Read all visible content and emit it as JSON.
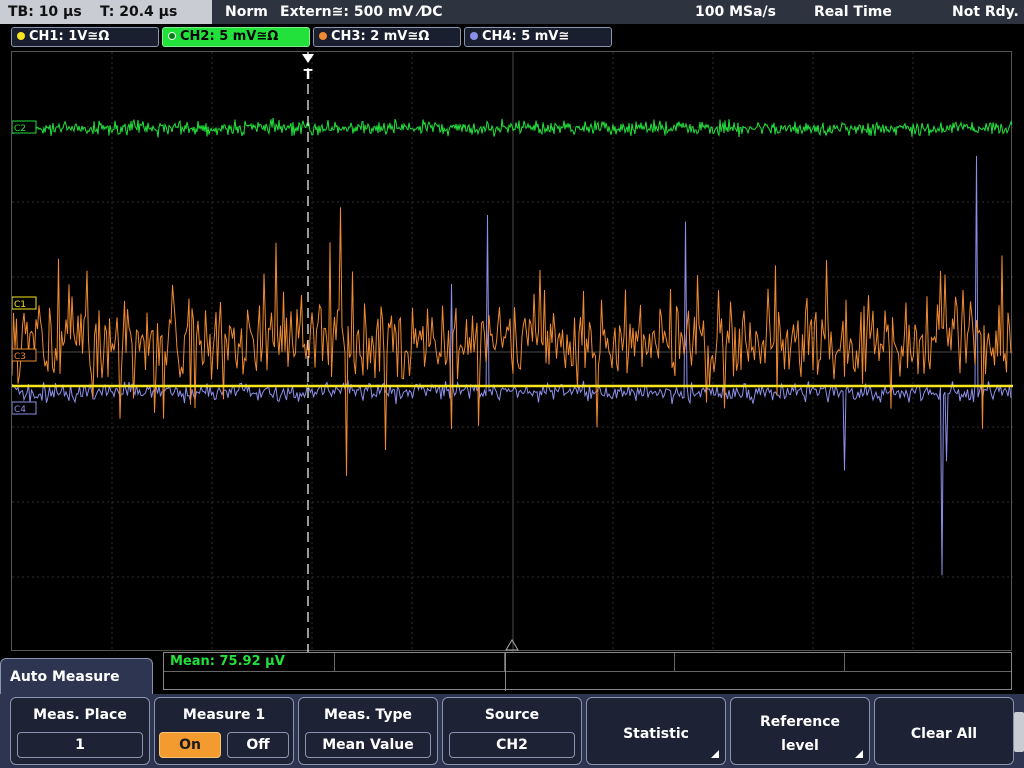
{
  "topbar": {
    "timebase": "TB: 10 µs",
    "trigger_time": "T: 20.4 µs",
    "mode": "Norm",
    "trigger_source": "Extern≅: 500 mV ⁄DC",
    "sample_rate": "100 MSa/s",
    "acq_mode": "Real Time",
    "status": "Not Rdy."
  },
  "channels": [
    {
      "label": "CH1: 1V≅Ω",
      "color": "#f7e51f"
    },
    {
      "label": "CH2: 5 mV≅Ω",
      "color": "#22e13b"
    },
    {
      "label": "CH3: 2 mV≅Ω",
      "color": "#f08a30"
    },
    {
      "label": "CH4: 5 mV≅",
      "color": "#8c8fe8"
    }
  ],
  "markers": {
    "c1": "C1",
    "c2": "C2",
    "c3": "C3",
    "c4": "C4",
    "trigger": "T"
  },
  "measurement": {
    "result": "Mean: 75.92 µV"
  },
  "menu": {
    "title": "Auto Measure",
    "meas_place": {
      "label": "Meas. Place",
      "value": "1"
    },
    "measure1": {
      "label": "Measure 1",
      "on": "On",
      "off": "Off"
    },
    "meas_type": {
      "label": "Meas. Type",
      "value": "Mean Value"
    },
    "source": {
      "label": "Source",
      "value": "CH2"
    },
    "statistic": {
      "label": "Statistic"
    },
    "reference": {
      "label_line1": "Reference",
      "label_line2": "level"
    },
    "clear_all": {
      "label": "Clear All"
    }
  }
}
